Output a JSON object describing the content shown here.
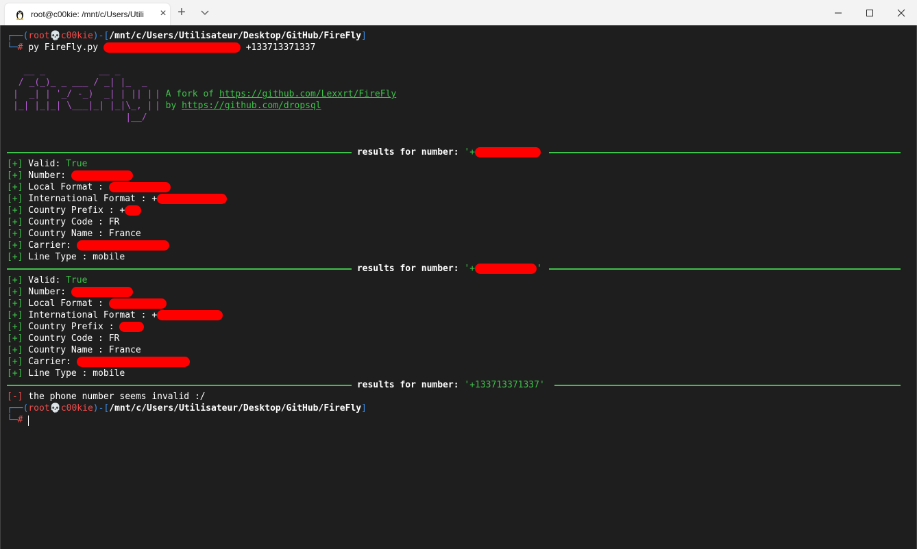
{
  "window": {
    "tab_title": "root@c00kie: /mnt/c/Users/Utili",
    "tab_close": "×",
    "new_tab": "+",
    "tab_icon": "linux-penguin-icon"
  },
  "prompt": {
    "user": "root",
    "host": "c00kie",
    "path": "/mnt/c/Users/Utilisateur/Desktop/GitHub/FireFly",
    "hash": "#"
  },
  "command": {
    "text": "py FireFly.py ",
    "last_arg": "+133713371337"
  },
  "banner": {
    "ascii_art": "  __ _          __ _\n / _(_)_ _ ___ / _| |_  _\n|  _| | '_/ -_)  _| | || |\n|_| |_|_| \\___|_| |_|\\_, |\n                     |__/",
    "fork_prefix": "A fork of ",
    "fork_url": "https://github.com/Lexxrt/FireFly",
    "by_prefix": "by ",
    "by_url": "https://github.com/dropsql"
  },
  "results": [
    {
      "header_prefix": " results for number: ",
      "header_number": "'+",
      "lines": {
        "tag": "[+]",
        "valid_label": " Valid: ",
        "valid_value": "True",
        "number_label": " Number: ",
        "local_label": " Local Format : ",
        "intl_label": " International Format : +",
        "prefix_label": " Country Prefix : +",
        "code_label": " Country Code : ",
        "code_value": "FR",
        "name_label": " Country Name : ",
        "name_value": "France",
        "carrier_label": " Carrier: ",
        "linetype_label": " Line Type : ",
        "linetype_value": "mobile"
      }
    },
    {
      "header_prefix": " results for number: ",
      "header_number": "'+",
      "header_close": "'",
      "lines": {
        "tag": "[+]",
        "valid_label": " Valid: ",
        "valid_value": "True",
        "number_label": " Number: ",
        "local_label": " Local Format : ",
        "intl_label": " International Format : +",
        "prefix_label": " Country Prefix : ",
        "code_label": " Country Code : ",
        "code_value": "FR",
        "name_label": " Country Name : ",
        "name_value": "France",
        "carrier_label": " Carrier: ",
        "linetype_label": " Line Type : ",
        "linetype_value": "mobile"
      }
    },
    {
      "header_prefix": " results for number: ",
      "header_number": "'+133713371337'",
      "error_tag": "[-]",
      "error_text": " the phone number seems invalid :/"
    }
  ],
  "colors": {
    "prompt_blue": "#3b8eea",
    "prompt_red": "#f14c4c",
    "ok_green": "#3fc24b",
    "banner_purple": "#b45ad1",
    "redaction": "#ff0000"
  }
}
